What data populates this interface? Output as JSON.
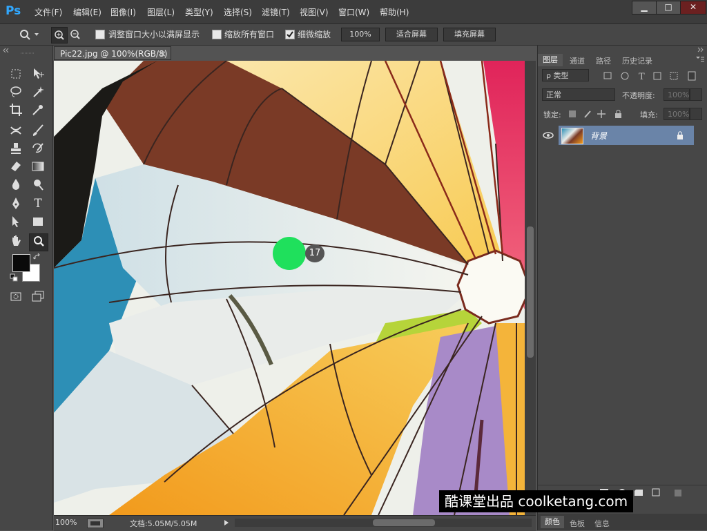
{
  "app": {
    "logo": "Ps"
  },
  "menu": [
    {
      "id": "file",
      "label": "文件(F)"
    },
    {
      "id": "edit",
      "label": "编辑(E)"
    },
    {
      "id": "image",
      "label": "图像(I)"
    },
    {
      "id": "layer",
      "label": "图层(L)"
    },
    {
      "id": "type",
      "label": "类型(Y)"
    },
    {
      "id": "select",
      "label": "选择(S)"
    },
    {
      "id": "filter",
      "label": "滤镜(T)"
    },
    {
      "id": "view",
      "label": "视图(V)"
    },
    {
      "id": "window",
      "label": "窗口(W)"
    },
    {
      "id": "help",
      "label": "帮助(H)"
    }
  ],
  "window_controls": {
    "minimize": "▁",
    "maximize": "□",
    "close": "✕"
  },
  "options": {
    "resize_windows_label": "调整窗口大小以满屏显示",
    "resize_windows_checked": false,
    "zoom_all_label": "缩放所有窗口",
    "zoom_all_checked": false,
    "scrubby_zoom_label": "细微缩放",
    "scrubby_zoom_checked": true,
    "zoom_value": "100%",
    "fit_screen_label": "适合屏幕",
    "fill_screen_label": "填充屏幕"
  },
  "document": {
    "tab_title": "Pic22.jpg @ 100%(RGB/8)",
    "close_glyph": "×",
    "cursor_step": "17"
  },
  "status": {
    "zoom": "100%",
    "doc_size": "文档:5.05M/5.05M"
  },
  "layers_panel": {
    "tabs": [
      "图层",
      "通道",
      "路径",
      "历史记录"
    ],
    "filter_label": "ρ 类型",
    "blend_mode": "正常",
    "opacity_label": "不透明度:",
    "opacity_value": "100%",
    "lock_label": "锁定:",
    "fill_label": "填充:",
    "fill_value": "100%",
    "layer_name": "背景"
  },
  "bottom_panel": {
    "tabs": [
      "颜色",
      "色板",
      "信息"
    ]
  },
  "watermark": "酷课堂出品 coolketang.com",
  "colors": {
    "foreground": "#0a0a0a",
    "background": "#ffffff",
    "cursor": "#1fe05c",
    "layer_selected": "#6a84a8"
  }
}
